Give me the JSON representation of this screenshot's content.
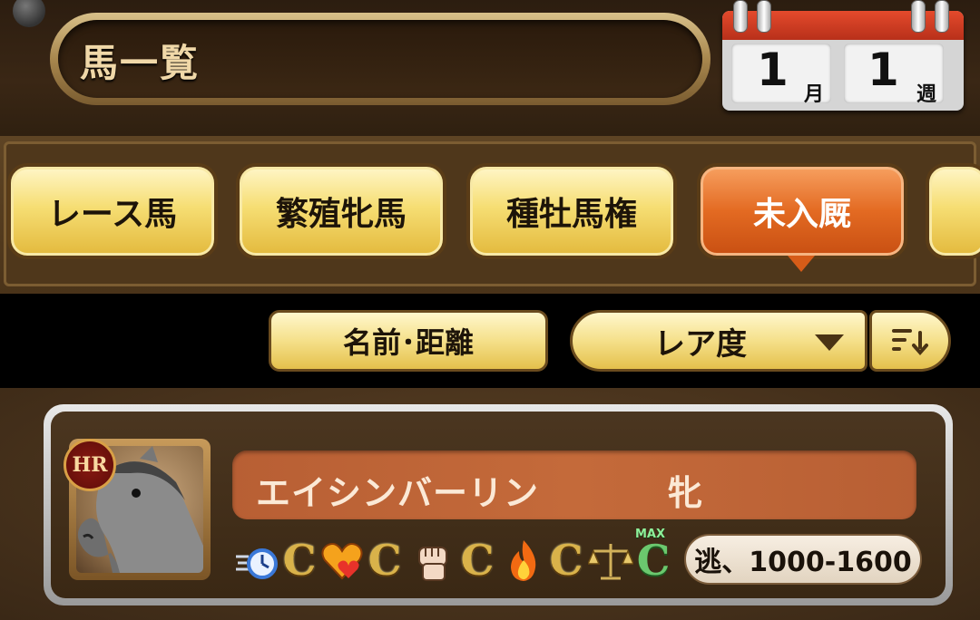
{
  "header": {
    "title": "馬一覧",
    "calendar": {
      "month": "1",
      "month_unit": "月",
      "week": "1",
      "week_unit": "週"
    }
  },
  "tabs": [
    {
      "label": "レース馬",
      "active": false
    },
    {
      "label": "繁殖牝馬",
      "active": false
    },
    {
      "label": "種牡馬権",
      "active": false
    },
    {
      "label": "未入厩",
      "active": true
    }
  ],
  "filters": {
    "sort_key_label": "名前･距離",
    "rarity_select_value": "レア度"
  },
  "horse_list": [
    {
      "rarity": "HR",
      "name": "エイシンバーリン",
      "sex": "牝",
      "stats": [
        {
          "icon": "speed-stopwatch-icon",
          "grade": "C"
        },
        {
          "icon": "heart-icon",
          "grade": "C"
        },
        {
          "icon": "fist-icon",
          "grade": "C"
        },
        {
          "icon": "flame-icon",
          "grade": "C"
        },
        {
          "icon": "scales-icon",
          "grade": "C",
          "max_label": "MAX"
        }
      ],
      "aptitude": "逃、1000-1600"
    }
  ],
  "colors": {
    "active_tab": "#e36a22",
    "tab": "#f6de74",
    "grade": "#d9b24a",
    "grade_max": "#6bc86e",
    "name_bar": "#c46a3a"
  }
}
